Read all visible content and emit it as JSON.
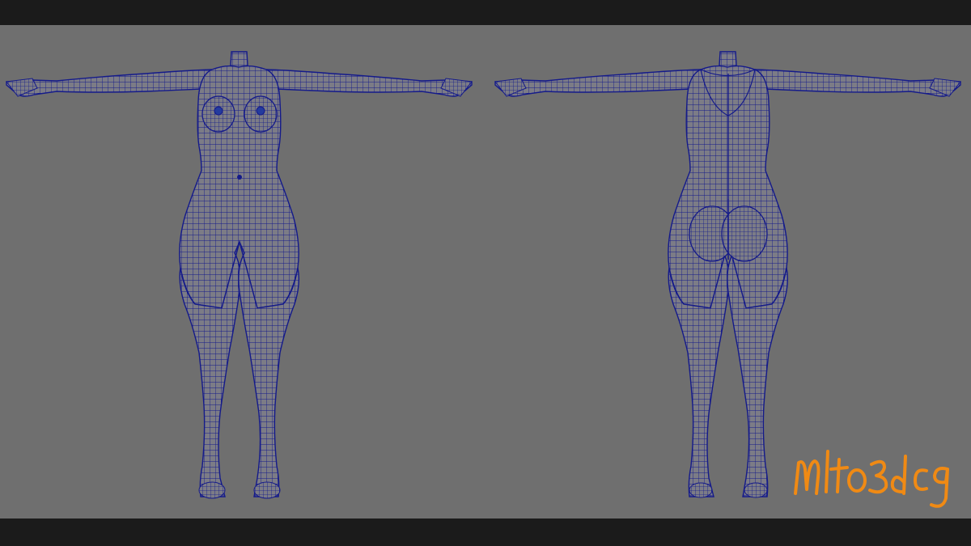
{
  "viewport": {
    "background_color": "#6f6f6f",
    "letterbox_color": "#1b1b1b"
  },
  "models": {
    "front_view": {
      "icon": "wireframe-body-front",
      "wire_color": "#141a8a",
      "fill_color": "#7c7c86"
    },
    "back_view": {
      "icon": "wireframe-body-back",
      "wire_color": "#141a8a",
      "fill_color": "#7c7c86"
    }
  },
  "watermark": {
    "text": "mlto3dcg",
    "color": "#f08a14"
  }
}
